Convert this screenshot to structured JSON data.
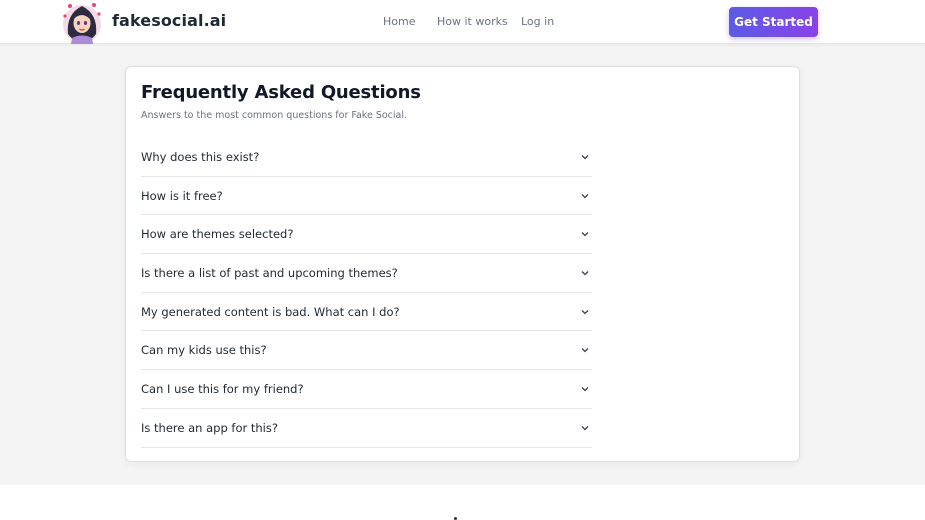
{
  "header": {
    "brand": "fakesocial.ai",
    "nav": {
      "home": "Home",
      "how_it_works": "How it works",
      "login": "Log in"
    },
    "cta_label": "Get Started"
  },
  "faq": {
    "title": "Frequently Asked Questions",
    "subtitle": "Answers to the most common questions for Fake Social.",
    "items": [
      "Why does this exist?",
      "How is it free?",
      "How are themes selected?",
      "Is there a list of past and upcoming themes?",
      "My generated content is bad. What can I do?",
      "Can my kids use this?",
      "Can I use this for my friend?",
      "Is there an app for this?"
    ]
  },
  "icons": {
    "logo": "avatar-woman-icon",
    "expand": "chevron-down-icon"
  },
  "colors": {
    "cta_gradient_start": "#5b5be6",
    "cta_gradient_end": "#8a42e8",
    "page_background": "#f4f4f4",
    "card_background": "#ffffff"
  }
}
